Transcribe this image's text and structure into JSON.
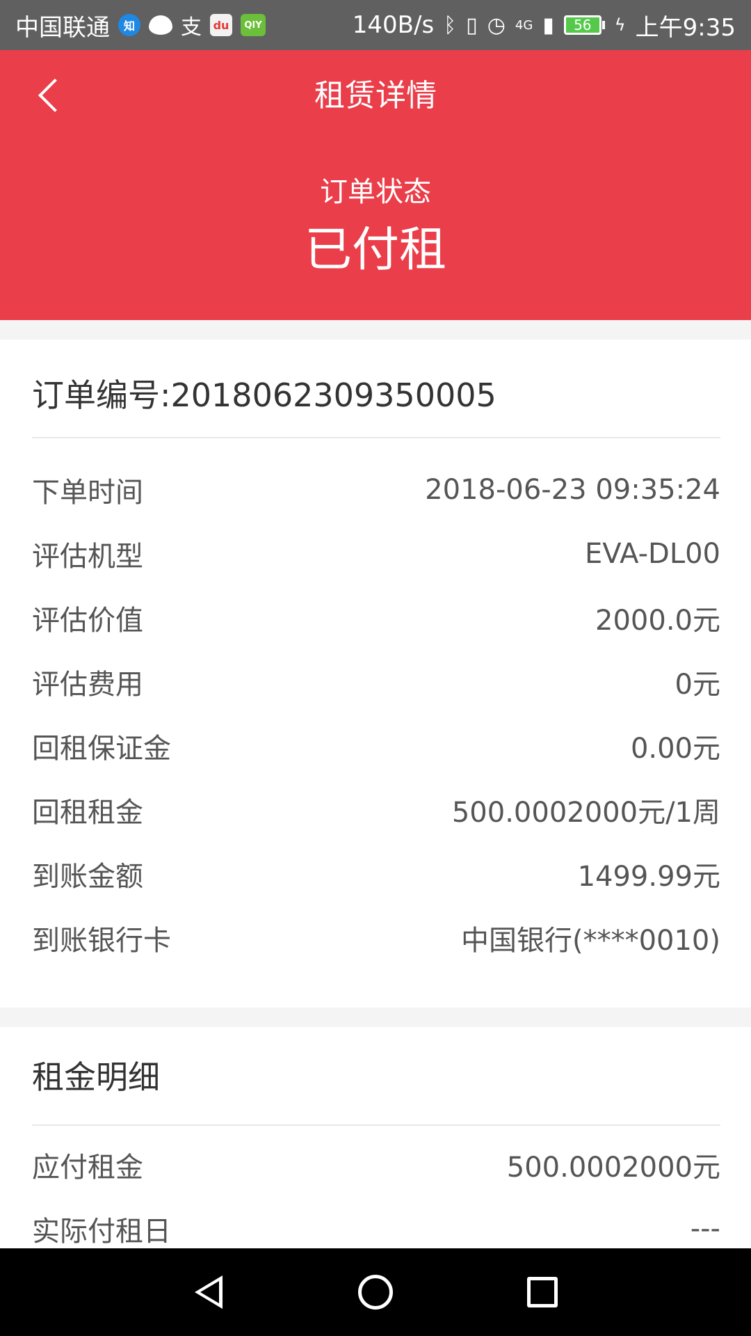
{
  "status_bar": {
    "carrier": "中国联通",
    "net_speed": "140B/s",
    "signal": "4G",
    "battery": "56",
    "time": "上午9:35"
  },
  "header": {
    "title": "租赁详情",
    "status_label": "订单状态",
    "status_value": "已付租",
    "background_color": "#ea3e4a"
  },
  "order": {
    "title": "订单编号:2018062309350005",
    "rows": [
      {
        "label": "下单时间",
        "value": "2018-06-23 09:35:24"
      },
      {
        "label": "评估机型",
        "value": "EVA-DL00"
      },
      {
        "label": "评估价值",
        "value": "2000.0元"
      },
      {
        "label": "评估费用",
        "value": "0元"
      },
      {
        "label": "回租保证金",
        "value": "0.00元"
      },
      {
        "label": "回租租金",
        "value": "500.0002000元/1周"
      },
      {
        "label": "到账金额",
        "value": "1499.99元"
      },
      {
        "label": "到账银行卡",
        "value": "中国银行(****0010)"
      }
    ]
  },
  "rent_detail": {
    "title": "租金明细",
    "rows": [
      {
        "label": "应付租金",
        "value": "500.0002000元"
      },
      {
        "label": "实际付租日",
        "value": "---"
      }
    ]
  },
  "icons": {
    "back": "back-arrow-icon",
    "nav_back": "nav-back-icon",
    "nav_home": "nav-home-icon",
    "nav_recent": "nav-recent-icon"
  }
}
